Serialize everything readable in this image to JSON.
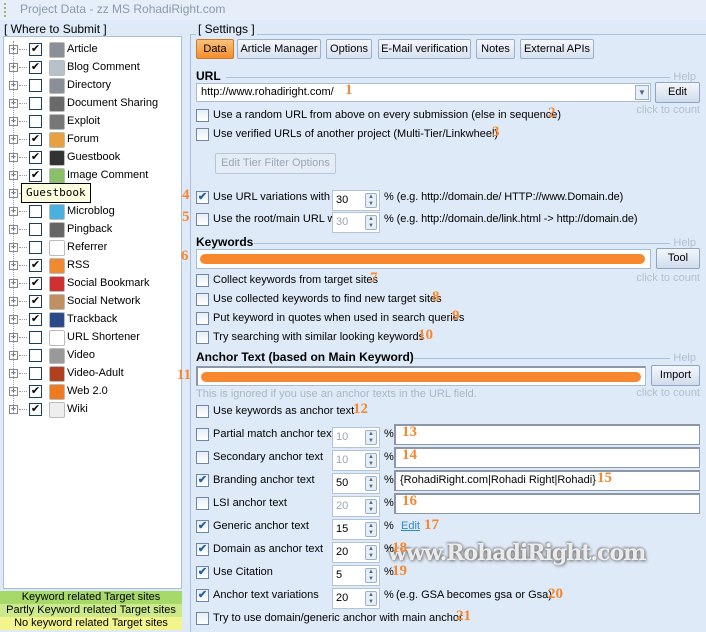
{
  "window": {
    "title": "Project Data - zz MS RohadiRight.com"
  },
  "sidebar": {
    "legend": "[ Where to Submit ]",
    "tooltip": "Guestbook",
    "items": [
      {
        "label": "Article",
        "checked": true,
        "icon": "article-icon",
        "color": "#8a8f98"
      },
      {
        "label": "Blog Comment",
        "checked": true,
        "icon": "speech-bubble-icon",
        "color": "#b8c0cc"
      },
      {
        "label": "Directory",
        "checked": false,
        "icon": "directory-icon",
        "color": "#8a8f98"
      },
      {
        "label": "Document Sharing",
        "checked": false,
        "icon": "folder-icon",
        "color": "#6a6a6a"
      },
      {
        "label": "Exploit",
        "checked": false,
        "icon": "bug-icon",
        "color": "#777"
      },
      {
        "label": "Forum",
        "checked": true,
        "icon": "people-icon",
        "color": "#e8a040"
      },
      {
        "label": "Guestbook",
        "checked": true,
        "icon": "book-icon",
        "color": "#333"
      },
      {
        "label": "Image Comment",
        "checked": true,
        "icon": "image-icon",
        "color": "#8ac068"
      },
      {
        "label": "",
        "checked": null,
        "icon": "",
        "color": ""
      },
      {
        "label": "Microblog",
        "checked": false,
        "icon": "twitter-icon",
        "color": "#4ab0e0"
      },
      {
        "label": "Pingback",
        "checked": false,
        "icon": "pingback-icon",
        "color": "#666"
      },
      {
        "label": "Referrer",
        "checked": false,
        "icon": "referrer-icon",
        "color": "#fff"
      },
      {
        "label": "RSS",
        "checked": true,
        "icon": "rss-icon",
        "color": "#f08a30"
      },
      {
        "label": "Social Bookmark",
        "checked": true,
        "icon": "heart-icon",
        "color": "#d03030"
      },
      {
        "label": "Social Network",
        "checked": true,
        "icon": "users-icon",
        "color": "#c09060"
      },
      {
        "label": "Trackback",
        "checked": true,
        "icon": "trackback-icon",
        "color": "#2a4a8a"
      },
      {
        "label": "URL Shortener",
        "checked": false,
        "icon": "double-chevron-icon",
        "color": "#fff"
      },
      {
        "label": "Video",
        "checked": false,
        "icon": "video-icon",
        "color": "#999"
      },
      {
        "label": "Video-Adult",
        "checked": false,
        "icon": "video-adult-icon",
        "color": "#b04020"
      },
      {
        "label": "Web 2.0",
        "checked": true,
        "icon": "blogger-icon",
        "color": "#f07a20"
      },
      {
        "label": "Wiki",
        "checked": true,
        "icon": "wikipedia-icon",
        "color": "#eee"
      }
    ],
    "legend_items": [
      {
        "label": "Keyword related Target sites",
        "color": "#a6d86a"
      },
      {
        "label": "Partly Keyword related Target sites",
        "color": "#ccea8c"
      },
      {
        "label": "No keyword related Target sites",
        "color": "#f4f48c"
      }
    ]
  },
  "settings": {
    "legend": "[ Settings ]",
    "tabs": [
      "Data",
      "Article Manager",
      "Options",
      "E-Mail verification",
      "Notes",
      "External APIs"
    ],
    "active_tab": "Data",
    "help": "Help",
    "click_to_count": "click to count",
    "url": {
      "heading": "URL",
      "value": "http://www.rohadiright.com/",
      "edit": "Edit",
      "options": [
        {
          "label": "Use a random URL from above on every submission (else in sequence)",
          "checked": false,
          "marker": "2"
        },
        {
          "label": "Use verified URLs of another project (Multi-Tier/Linkwheel)",
          "checked": false,
          "marker": "3"
        }
      ],
      "tier_button": "Edit Tier Filter Options",
      "variations": {
        "label": "Use URL variations with",
        "checked": true,
        "value": "30",
        "note": "% (e.g. http://domain.de/ HTTP://www.Domain.de)",
        "marker": "4"
      },
      "root": {
        "label": "Use the root/main URL with",
        "checked": false,
        "value": "30",
        "note": "% (e.g. http://domain.de/link.html -> http://domain.de)",
        "marker": "5"
      },
      "marker": "1"
    },
    "keywords": {
      "heading": "Keywords",
      "tool": "Tool",
      "marker": "6",
      "options": [
        {
          "label": "Collect keywords from target sites",
          "checked": false,
          "marker": "7"
        },
        {
          "label": "Use collected keywords to find new target sites",
          "checked": false,
          "marker": "8"
        },
        {
          "label": "Put keyword in quotes when used in search queries",
          "checked": false,
          "marker": "9"
        },
        {
          "label": "Try searching with similar looking keywords",
          "checked": false,
          "marker": "10"
        }
      ]
    },
    "anchor": {
      "heading": "Anchor Text (based on Main Keyword)",
      "import": "Import",
      "marker": "11",
      "note": "This is ignored if you use an anchor texts in the URL field.",
      "use_keywords": {
        "label": "Use keywords as anchor text",
        "checked": false,
        "marker": "12"
      },
      "rows": [
        {
          "label": "Partial match anchor text",
          "checked": false,
          "value": "10",
          "text": "",
          "marker": "13",
          "kind": "text"
        },
        {
          "label": "Secondary anchor text",
          "checked": false,
          "value": "10",
          "text": "",
          "marker": "14",
          "kind": "text"
        },
        {
          "label": "Branding anchor text",
          "checked": true,
          "value": "50",
          "text": "{RohadiRight.com|Rohadi Right|Rohadi}",
          "marker": "15",
          "kind": "text"
        },
        {
          "label": "LSI anchor text",
          "checked": false,
          "value": "20",
          "text": "",
          "marker": "16",
          "kind": "text"
        },
        {
          "label": "Generic anchor text",
          "checked": true,
          "value": "15",
          "link": "Edit",
          "marker": "17",
          "kind": "link"
        },
        {
          "label": "Domain as anchor text",
          "checked": true,
          "value": "20",
          "marker": "18",
          "kind": "none"
        },
        {
          "label": "Use Citation",
          "checked": true,
          "value": "5",
          "marker": "19",
          "kind": "none"
        },
        {
          "label": "Anchor text variations",
          "checked": true,
          "value": "20",
          "note": "(e.g. GSA becomes gsa or Gsa)",
          "marker": "20",
          "kind": "note"
        }
      ],
      "domain_generic": {
        "label": "Try to use domain/generic anchor with main anchor",
        "checked": false,
        "marker": "21"
      }
    }
  },
  "watermark": "www.RohadiRight.com",
  "colors": {
    "marker": "#f7882f",
    "active_tab": "#f58e2c",
    "background": "#dfeaf8"
  }
}
